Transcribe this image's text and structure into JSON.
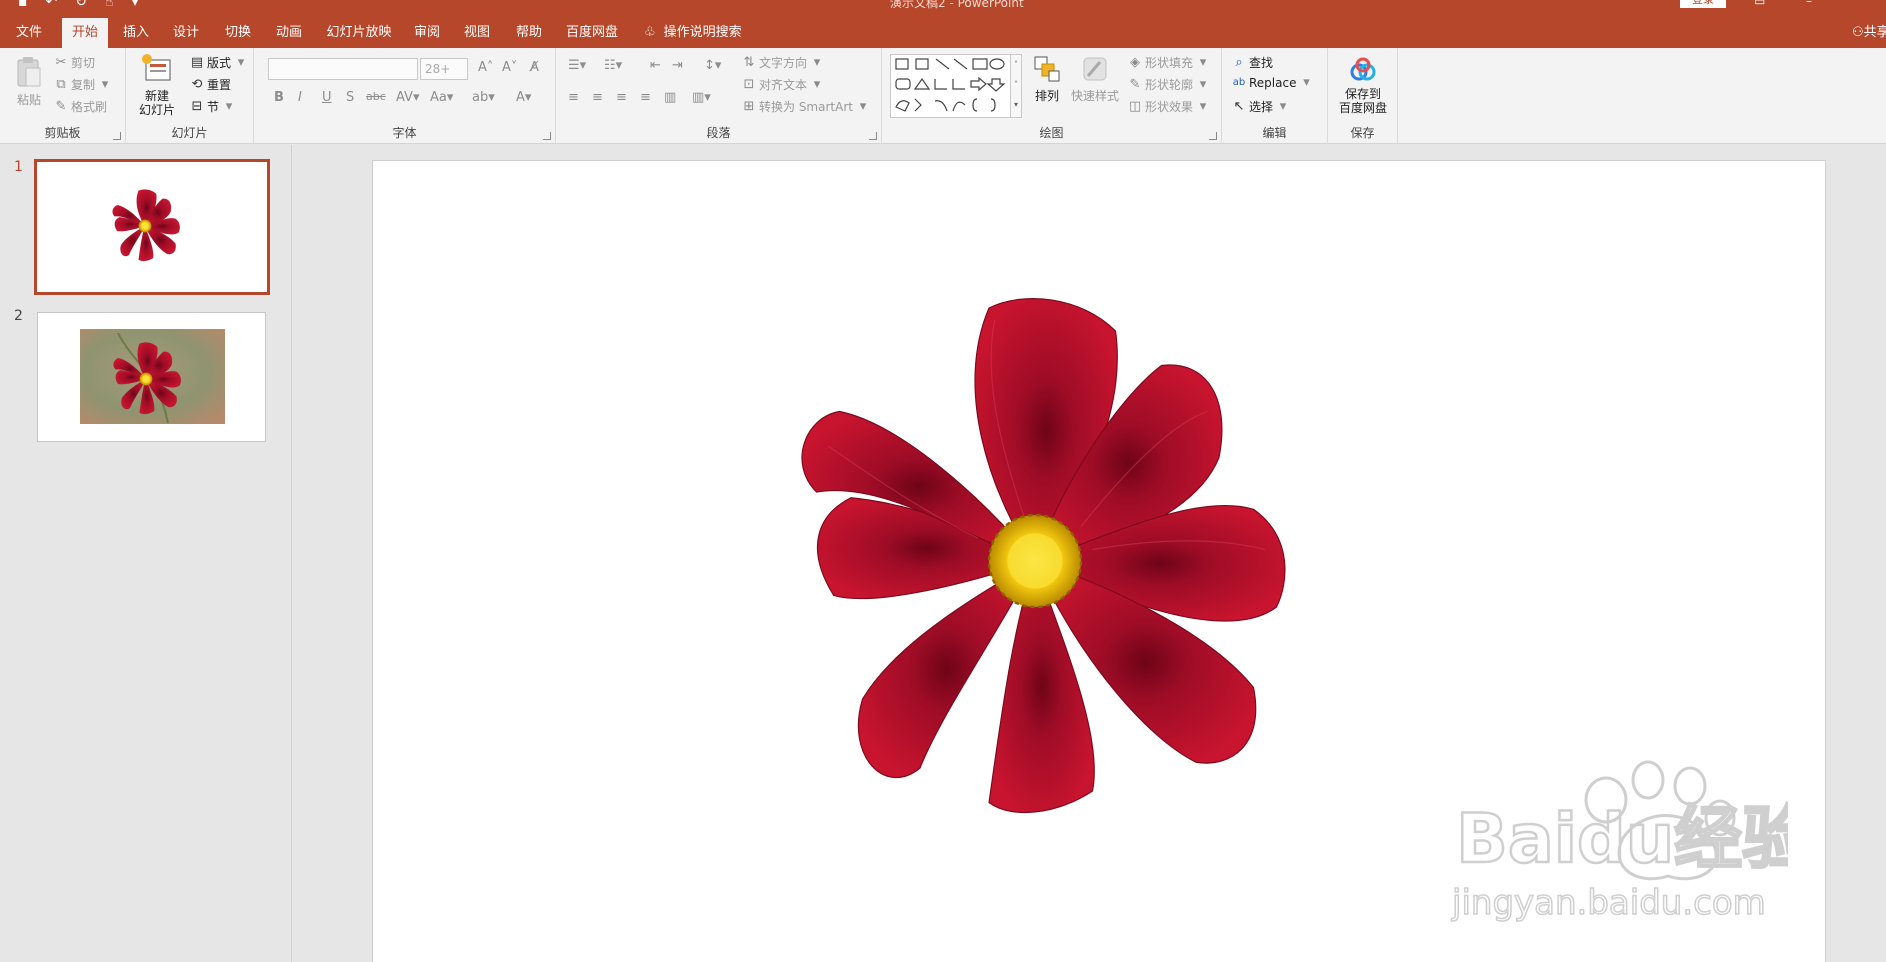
{
  "colors": {
    "accent": "#b7472a",
    "ribbon_bg": "#f3f3f3",
    "pane_bg": "#e6e6e6",
    "petal": "#b0102c",
    "flower_center": "#f2c80f"
  },
  "titlebar": {
    "doc_title": "演示文稿2 - PowerPoint",
    "login": "登录"
  },
  "tabs": [
    {
      "label": "文件"
    },
    {
      "label": "开始",
      "active": true
    },
    {
      "label": "插入"
    },
    {
      "label": "设计"
    },
    {
      "label": "切换"
    },
    {
      "label": "动画"
    },
    {
      "label": "幻灯片放映"
    },
    {
      "label": "审阅"
    },
    {
      "label": "视图"
    },
    {
      "label": "帮助"
    },
    {
      "label": "百度网盘"
    }
  ],
  "tell_me": "操作说明搜索",
  "share": "共享",
  "ribbon": {
    "clipboard": {
      "label": "剪贴板",
      "paste": "粘贴",
      "cut": "剪切",
      "copy": "复制",
      "format_painter": "格式刷"
    },
    "slides": {
      "label": "幻灯片",
      "new_slide_line1": "新建",
      "new_slide_line2": "幻灯片",
      "layout": "版式",
      "reset": "重置",
      "section": "节"
    },
    "font": {
      "label": "字体",
      "font_name": "",
      "font_size": "28+"
    },
    "paragraph": {
      "label": "段落",
      "text_direction": "文字方向",
      "align_text": "对齐文本",
      "convert_smartart": "转换为 SmartArt"
    },
    "drawing": {
      "label": "绘图",
      "arrange": "排列",
      "quick_styles": "快速样式",
      "shape_fill": "形状填充",
      "shape_outline": "形状轮廓",
      "shape_effects": "形状效果"
    },
    "editing": {
      "label": "编辑",
      "find": "查找",
      "replace": "Replace",
      "select": "选择"
    },
    "save": {
      "label": "保存",
      "save_line1": "保存到",
      "save_line2": "百度网盘"
    }
  },
  "slides_pane": [
    {
      "number": "1",
      "selected": true
    },
    {
      "number": "2",
      "selected": false
    }
  ],
  "watermark": {
    "brand": "Baidu经验",
    "url": "jingyan.baidu.com"
  }
}
